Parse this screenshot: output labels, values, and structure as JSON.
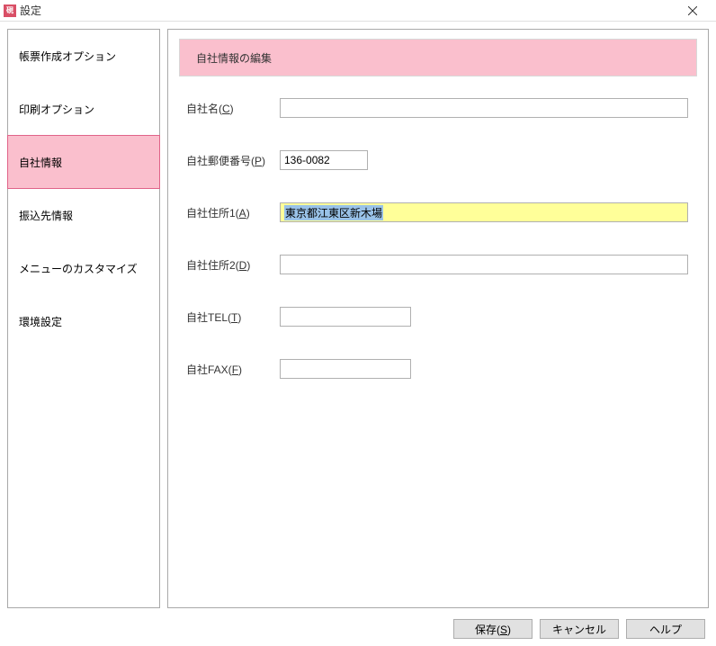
{
  "titlebar": {
    "title": "設定",
    "icon_text": "硯"
  },
  "sidebar": {
    "items": [
      {
        "label": "帳票作成オプション"
      },
      {
        "label": "印刷オプション"
      },
      {
        "label": "自社情報"
      },
      {
        "label": "振込先情報"
      },
      {
        "label": "メニューのカスタマイズ"
      },
      {
        "label": "環境設定"
      }
    ],
    "active_index": 2
  },
  "panel": {
    "header": "自社情報の編集",
    "fields": {
      "company_name": {
        "label_pre": "自社名(",
        "label_u": "C",
        "label_post": ")",
        "value": ""
      },
      "postal": {
        "label_pre": "自社郵便番号(",
        "label_u": "P",
        "label_post": ")",
        "value": "136-0082"
      },
      "address1": {
        "label_pre": "自社住所1(",
        "label_u": "A",
        "label_post": ")",
        "value": "東京都江東区新木場"
      },
      "address2": {
        "label_pre": "自社住所2(",
        "label_u": "D",
        "label_post": ")",
        "value": ""
      },
      "tel": {
        "label_pre": "自社TEL(",
        "label_u": "T",
        "label_post": ")",
        "value": ""
      },
      "fax": {
        "label_pre": "自社FAX(",
        "label_u": "F",
        "label_post": ")",
        "value": ""
      }
    }
  },
  "footer": {
    "save": {
      "pre": "保存(",
      "u": "S",
      "post": ")"
    },
    "cancel": "キャンセル",
    "help": "ヘルプ"
  }
}
